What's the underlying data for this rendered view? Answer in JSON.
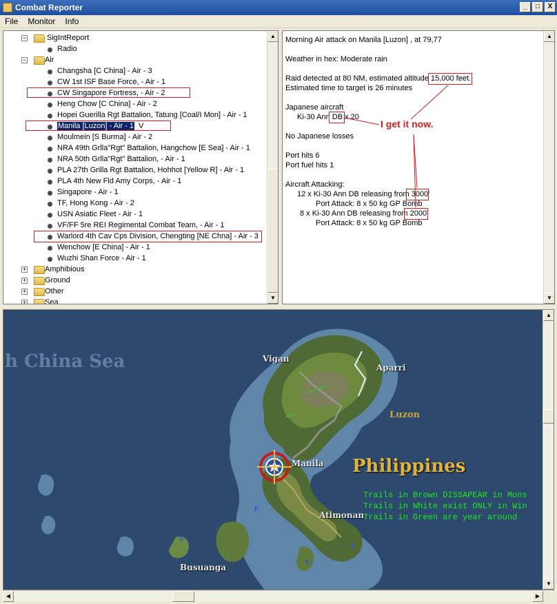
{
  "window": {
    "title": "Combat Reporter",
    "minimize_label": "_",
    "maximize_label": "□",
    "close_label": "X"
  },
  "menu": [
    "File",
    "Monitor",
    "Info"
  ],
  "tree": {
    "sigint": "SigIntReport",
    "radio": "Radio",
    "air": "Air",
    "air_items": [
      "Changsha [C China]  - Air - 3",
      "CW 1st ISF Base Force,  - Air - 1",
      "CW Singapore Fortress,  - Air - 2",
      "Heng Chow [C China]  - Air - 2",
      "Hopei Guerilla Rgt Battalion, Tatung [Coal/I Mon]  - Air - 1",
      "Manila [Luzon]  - Air - 1",
      "Moulmein [S Burma]  - Air - 2",
      "NRA 49th Grlla\"Rgt\" Battalion, Hangchow [E Sea]  - Air - 1",
      "NRA 50th Grlla\"Rgt\" Battalion,  - Air - 1",
      "PLA 27th Grilla Rgt Battalion, Hohhot [Yellow R]  - Air - 1",
      "PLA 4th New Fld Amy Corps,  - Air - 1",
      "Singapore  - Air - 1",
      "TF, Hong Kong  - Air - 2",
      "USN Asiatic Fleet  - Air - 1",
      "VF/FF 5re REI Regimental Combat Team,  - Air - 1",
      "Warlord 4th Cav Cps Division, Chengting [NE Chna]  - Air - 3",
      "Wenchow [E China]  - Air - 1",
      "Wuzhi Shan Force  - Air - 1"
    ],
    "other_folders": [
      "Amphibious",
      "Ground",
      "Other",
      "Sea"
    ],
    "hand_mark": "V"
  },
  "report": {
    "heading": "Morning Air attack on Manila [Luzon] , at 79,77",
    "weather": "Weather in hex: Moderate rain",
    "raid_prefix": "Raid detected at 80 NM, estimated altitude",
    "raid_altitude": "15,000 feet.",
    "eta": "Estimated time to target is 26 minutes",
    "jp_aircraft_label": "Japanese aircraft",
    "aircraft_prefix": "Ki-30 Ann",
    "aircraft_type": "DB",
    "aircraft_count": "x 20",
    "losses": "No Japanese losses",
    "port_hits": "Port hits 6",
    "port_fuel_hits": "Port fuel hits 1",
    "attacking_label": "Aircraft Attacking:",
    "attack1_prefix": "12 x Ki-30 Ann DB releasing from",
    "attack1_alt": "3000'",
    "attack1_detail": "Port Attack:  8 x 50 kg GP Bomb",
    "attack2_prefix": "8 x Ki-30 Ann DB releasing from",
    "attack2_alt": "2000'",
    "attack2_detail": "Port Attack:  8 x 50 kg GP Bomb",
    "annotation": "I get it now."
  },
  "map": {
    "sea_label": "h China Sea",
    "country_label": "Philippines",
    "region_label": "Luzon",
    "cities": [
      "Vigan",
      "Aparri",
      "Manila",
      "Atimonan",
      "Busuanga"
    ],
    "hex_marker": "F",
    "legend": [
      "Trails in Brown DISSAPEAR in Mons",
      "Trails in White exist ONLY in Win",
      "Trails in Green are year around"
    ]
  }
}
